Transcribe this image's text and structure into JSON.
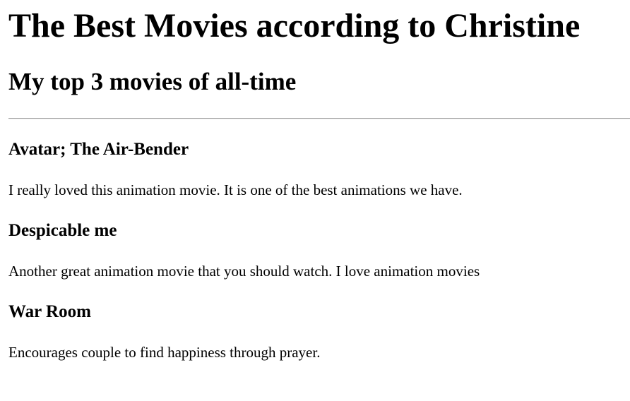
{
  "page": {
    "title": "The Best Movies according to Christine",
    "subtitle": "My top 3 movies of all-time"
  },
  "movies": [
    {
      "title": "Avatar; The Air-Bender",
      "description": "I really loved this animation movie. It is one of the best animations we have."
    },
    {
      "title": "Despicable me",
      "description": "Another great animation movie that you should watch. I love animation movies"
    },
    {
      "title": "War Room",
      "description": "Encourages couple to find happiness through prayer."
    }
  ]
}
